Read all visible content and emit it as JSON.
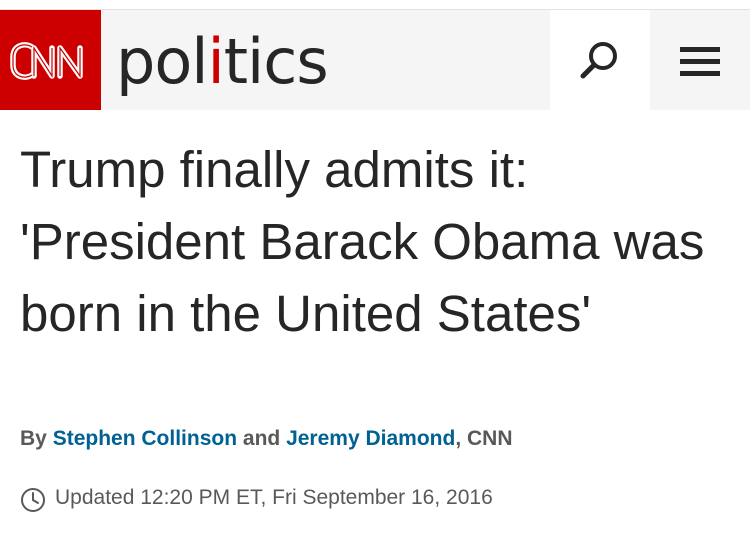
{
  "header": {
    "brand": "CNN",
    "section_prefix": "pol",
    "section_accent": "i",
    "section_suffix": "tics",
    "search_icon": "search-icon",
    "menu_icon": "hamburger-menu-icon",
    "colors": {
      "brand_red": "#cc0000",
      "header_bg": "#f5f5f5",
      "link_blue": "#006193",
      "text_dark": "#262626",
      "text_grey": "#595959"
    }
  },
  "article": {
    "headline": "Trump finally admits it: 'President Barack Obama was born in the United States'",
    "byline": {
      "prefix": "By",
      "author1": "Stephen Collinson",
      "conjunction": "and",
      "author2": "Jeremy Diamond",
      "suffix": ", CNN"
    },
    "timestamp": {
      "icon": "clock-icon",
      "text": "Updated 12:20 PM ET, Fri September 16, 2016"
    }
  }
}
